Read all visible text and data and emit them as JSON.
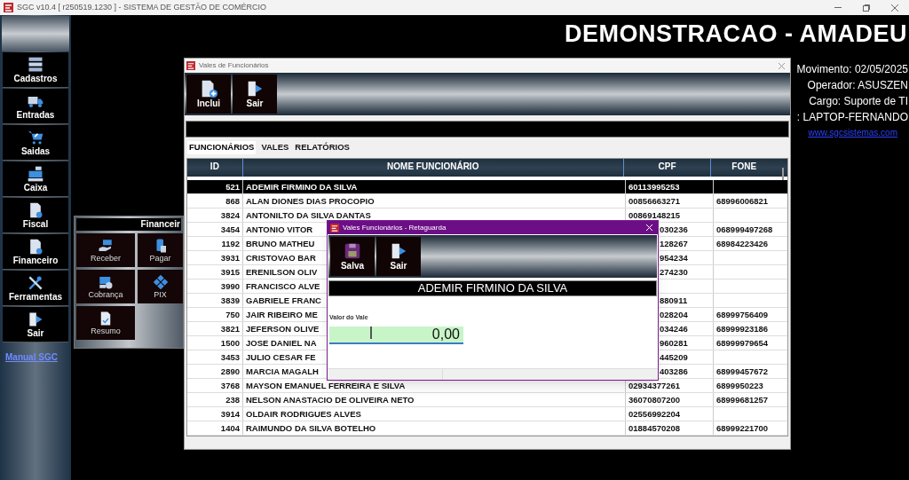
{
  "app": {
    "title": "SGC v10.4 [ r250519.1230 ] - SISTEMA DE GESTÃO DE COMÉRCIO"
  },
  "header": {
    "company": "DEMONSTRACAO - AMADEU",
    "info": [
      "Movimento: 02/05/2025",
      "Operador: ASUSZEN",
      "Cargo: Suporte de TI",
      ": LAPTOP-FERNANDO"
    ],
    "link": "www.sgcsistemas.com"
  },
  "sidebar": {
    "items": [
      {
        "label": "Cadastros"
      },
      {
        "label": "Entradas"
      },
      {
        "label": "Saidas"
      },
      {
        "label": "Caixa"
      },
      {
        "label": "Fiscal"
      },
      {
        "label": "Financeiro"
      },
      {
        "label": "Ferramentas"
      },
      {
        "label": "Sair"
      }
    ],
    "link": "Manual SGC"
  },
  "financeiro_panel": {
    "title": "Financeir",
    "buttons": [
      {
        "label": "Receber"
      },
      {
        "label": "Pagar"
      },
      {
        "label": "Cobrança"
      },
      {
        "label": "PIX"
      },
      {
        "label": "Resumo"
      }
    ]
  },
  "vales_window": {
    "title": "Vales de Funcionários",
    "toolbar": [
      {
        "label": "Inclui"
      },
      {
        "label": "Sair"
      }
    ],
    "tabs": [
      {
        "label": "FUNCIONÁRIOS",
        "selected": true
      },
      {
        "label": "VALES",
        "selected": false
      },
      {
        "label": "RELATÓRIOS",
        "selected": false
      }
    ],
    "table": {
      "columns": [
        "ID",
        "NOME FUNCIONÁRIO",
        "CPF",
        "FONE"
      ],
      "rows": [
        {
          "id": "521",
          "name": "ADEMIR FIRMINO DA SILVA",
          "cpf": "60113995253",
          "selected": true
        },
        {
          "id": "868",
          "name": "ALAN DIONES DIAS PROCOPIO",
          "cpf": "00856663271",
          "fone": "68996006821",
          "selected": false
        },
        {
          "id": "3824",
          "name": "ANTONILTO DA SILVA DANTAS",
          "cpf": "00869148215",
          "selected": false
        },
        {
          "id": "3454",
          "name": "ANTONIO VITOR",
          "cpf": "030236",
          "fone": "068999497268",
          "selected": false
        },
        {
          "id": "1192",
          "name": "BRUNO MATHEU",
          "cpf": "128267",
          "fone": "68984223426",
          "selected": false
        },
        {
          "id": "3931",
          "name": "CRISTOVAO BAR",
          "cpf": "954234",
          "selected": false
        },
        {
          "id": "3915",
          "name": "ERENILSON OLIV",
          "cpf": "274230",
          "selected": false
        },
        {
          "id": "3990",
          "name": "FRANCISCO ALVE",
          "selected": false
        },
        {
          "id": "3839",
          "name": "GABRIELE FRANC",
          "cpf": "880911",
          "selected": false
        },
        {
          "id": "750",
          "name": "JAIR RIBEIRO ME",
          "cpf": "028204",
          "fone": "68999756409",
          "selected": false
        },
        {
          "id": "3821",
          "name": "JEFERSON OLIVE",
          "cpf": "034246",
          "fone": "68999923186",
          "selected": false
        },
        {
          "id": "1500",
          "name": "JOSE DANIEL NA",
          "cpf": "960281",
          "fone": "68999979654",
          "selected": false
        },
        {
          "id": "3453",
          "name": "JULIO CESAR FE",
          "cpf": "445209",
          "selected": false
        },
        {
          "id": "2890",
          "name": "MARCIA MAGALH",
          "cpf": "403286",
          "fone": "68999457672",
          "selected": false
        },
        {
          "id": "3768",
          "name": "MAYSON EMANUEL FERREIRA E SILVA",
          "cpf": "02934377261",
          "fone": "6899950223",
          "selected": false
        },
        {
          "id": "238",
          "name": "NELSON ANASTACIO DE OLIVEIRA NETO",
          "cpf": "36070807200",
          "fone": "68999681257",
          "selected": false
        },
        {
          "id": "3914",
          "name": "OLDAIR RODRIGUES ALVES",
          "cpf": "02556992204",
          "selected": false
        },
        {
          "id": "1404",
          "name": "RAIMUNDO DA SILVA BOTELHO",
          "cpf": "01884570208",
          "fone": "68999221700",
          "selected": false
        }
      ]
    }
  },
  "dialog": {
    "title": "Vales Funcionários - Retaguarda",
    "toolbar": [
      {
        "label": "Salva"
      },
      {
        "label": "Sair"
      }
    ],
    "employee": "ADEMIR FIRMINO DA SILVA",
    "field": {
      "label": "Valor do Vale",
      "value": "0,00"
    }
  }
}
